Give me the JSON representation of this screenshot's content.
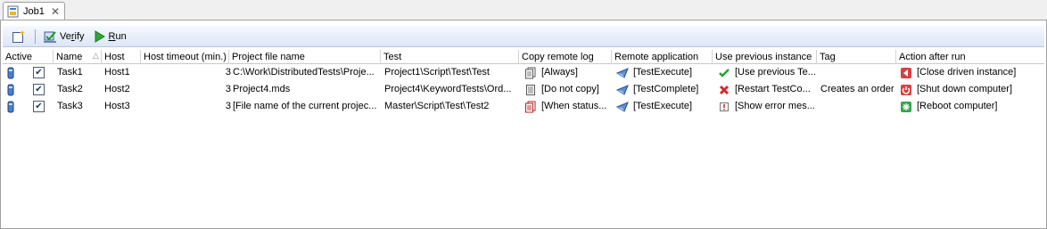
{
  "tab": {
    "label": "Job1",
    "close": "✕"
  },
  "toolbar": {
    "verify_label": "Verify",
    "run_label": "Run"
  },
  "columns": [
    "Active",
    "Name",
    "Host",
    "Host timeout (min.)",
    "Project file name",
    "Test",
    "Copy remote log",
    "Remote application",
    "Use previous instance",
    "Tag",
    "Action after run"
  ],
  "sort_indicator": "△",
  "rows": [
    {
      "name": "Task1",
      "host": "Host1",
      "timeout": "3",
      "project": "C:\\Work\\DistributedTests\\Proje...",
      "test": "Project1\\Script\\Test\\Test",
      "copy_log": "[Always]",
      "remote_app": "[TestExecute]",
      "use_prev": "[Use previous Te...",
      "tag": "",
      "action": "[Close driven instance]"
    },
    {
      "name": "Task2",
      "host": "Host2",
      "timeout": "3",
      "project": "Project4.mds",
      "test": "Project4\\KeywordTests\\Ord...",
      "copy_log": "[Do not copy]",
      "remote_app": "[TestComplete]",
      "use_prev": "[Restart TestCo...",
      "tag": "Creates an order",
      "action": "[Shut down computer]"
    },
    {
      "name": "Task3",
      "host": "Host3",
      "timeout": "3",
      "project": "[File name of the current projec...",
      "test": "Master\\Script\\Test\\Test2",
      "copy_log": "[When status...",
      "remote_app": "[TestExecute]",
      "use_prev": "[Show error mes...",
      "tag": "",
      "action": "[Reboot computer]"
    }
  ],
  "checked_mark": "✔"
}
